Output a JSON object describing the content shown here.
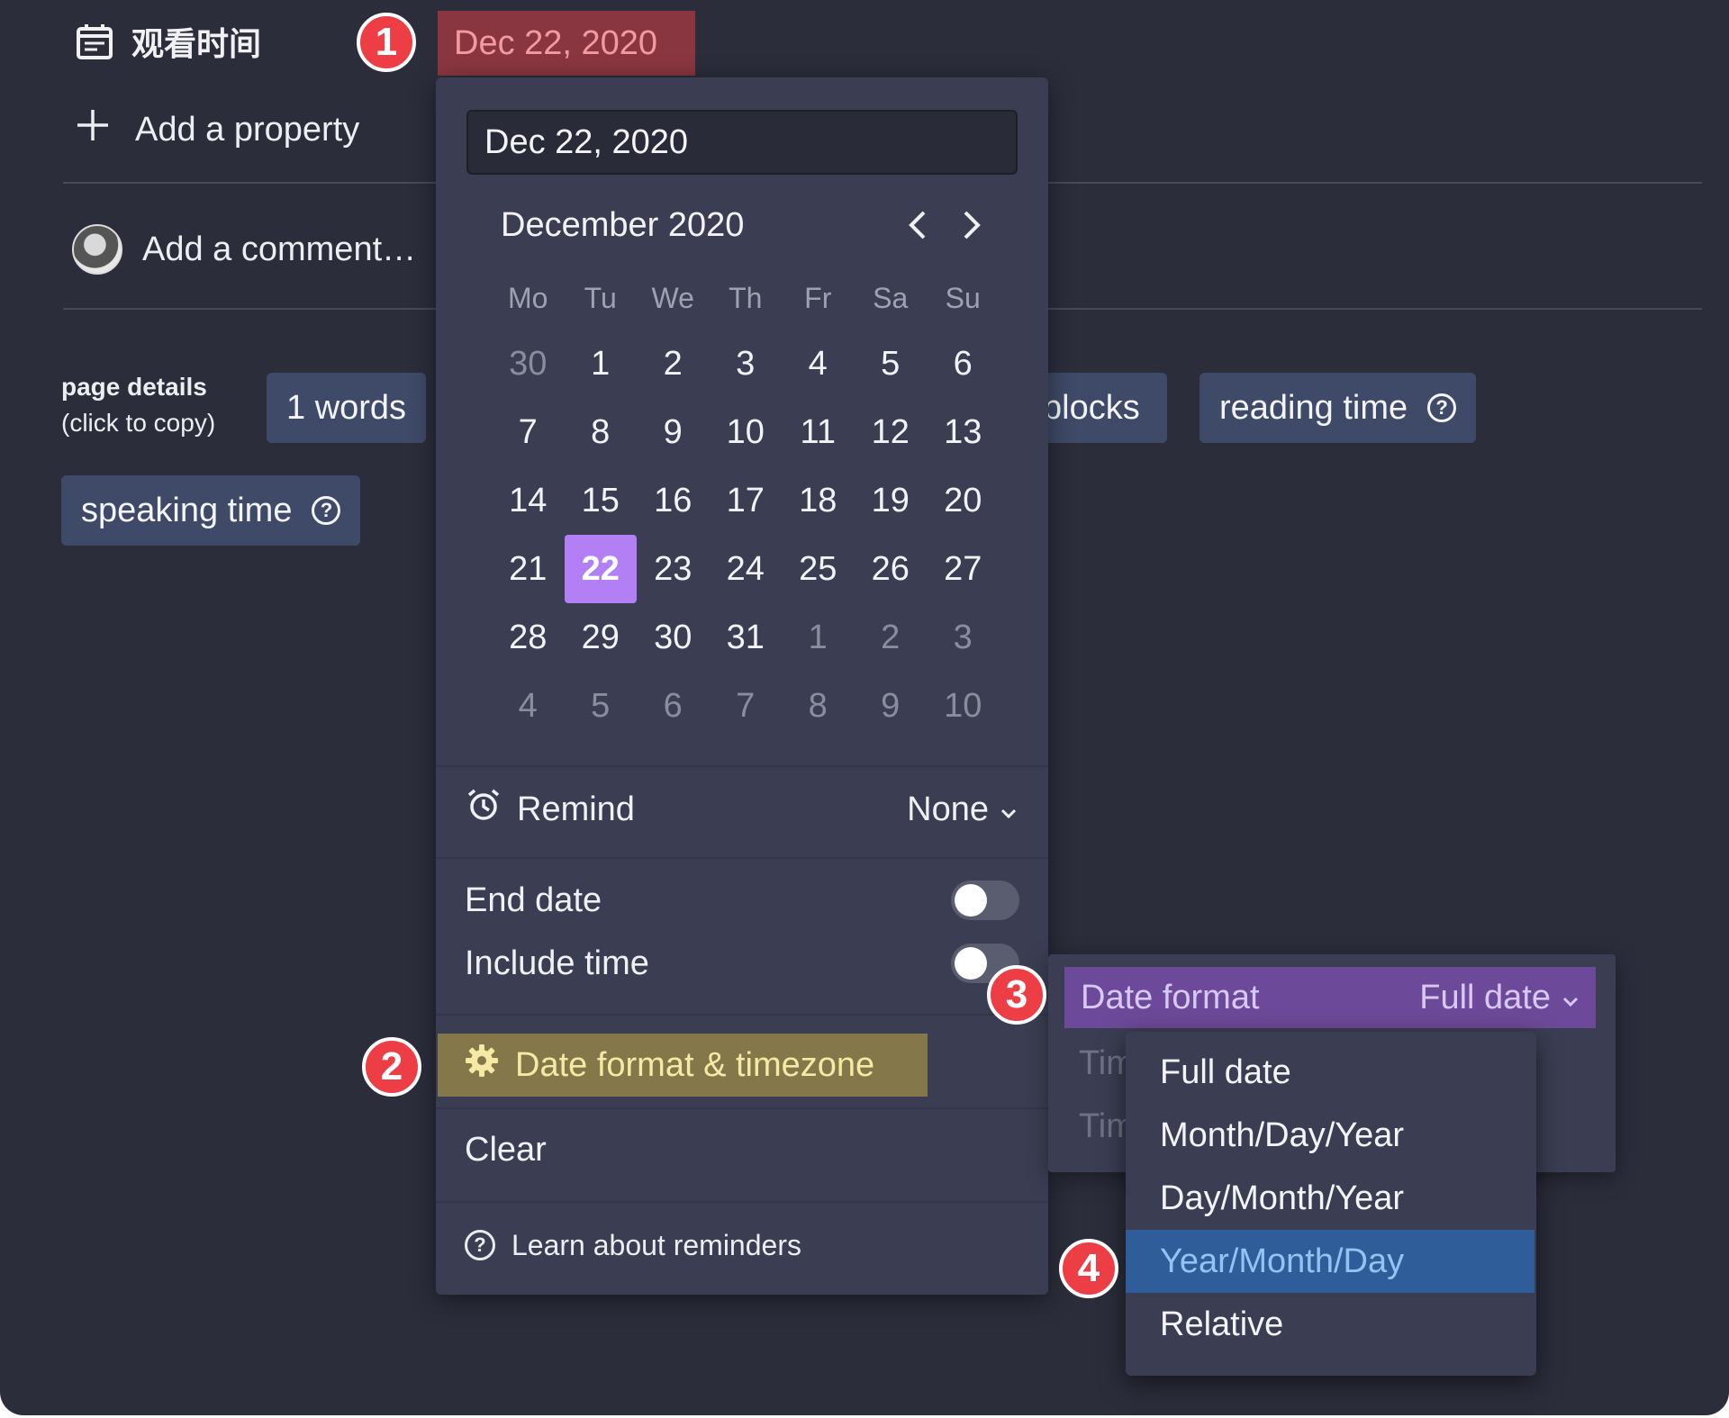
{
  "property": {
    "name": "观看时间",
    "icon": "calendar-icon",
    "value": "Dec 22, 2020"
  },
  "add_property": {
    "label": "Add a property",
    "icon": "plus-icon"
  },
  "add_comment": {
    "placeholder": "Add a comment…"
  },
  "page_details": {
    "title": "page details",
    "subtitle": "(click to copy)",
    "pills": [
      {
        "label": "1 words"
      },
      {
        "label": "blocks"
      },
      {
        "label": "reading time",
        "icon": "help-icon"
      },
      {
        "label": "speaking time",
        "icon": "help-icon"
      }
    ]
  },
  "picker": {
    "input_value": "Dec 22, 2020",
    "month_label": "December 2020",
    "weekdays": [
      "Mo",
      "Tu",
      "We",
      "Th",
      "Fr",
      "Sa",
      "Su"
    ],
    "weeks": [
      [
        "30",
        "1",
        "2",
        "3",
        "4",
        "5",
        "6"
      ],
      [
        "7",
        "8",
        "9",
        "10",
        "11",
        "12",
        "13"
      ],
      [
        "14",
        "15",
        "16",
        "17",
        "18",
        "19",
        "20"
      ],
      [
        "21",
        "22",
        "23",
        "24",
        "25",
        "26",
        "27"
      ],
      [
        "28",
        "29",
        "30",
        "31",
        "1",
        "2",
        "3"
      ],
      [
        "4",
        "5",
        "6",
        "7",
        "8",
        "9",
        "10"
      ]
    ],
    "selected_day": "22",
    "remind_label": "Remind",
    "remind_value": "None",
    "end_date_label": "End date",
    "end_date_on": false,
    "include_time_label": "Include time",
    "include_time_on": false,
    "date_format_button": "Date format & timezone",
    "clear_label": "Clear",
    "learn_label": "Learn about reminders"
  },
  "format_panel": {
    "label": "Date format",
    "value": "Full date",
    "ghost_rows": [
      "Tim",
      "Tim"
    ]
  },
  "format_options": [
    "Full date",
    "Month/Day/Year",
    "Day/Month/Year",
    "Year/Month/Day",
    "Relative"
  ],
  "format_highlighted": "Year/Month/Day",
  "badges": [
    "1",
    "2",
    "3",
    "4"
  ],
  "colors": {
    "background": "#2b2d3b",
    "popup": "#3b3e53",
    "selected_day": "#b37ff4",
    "date_chip": "#8a3641",
    "date_format_button": "#84784b",
    "format_header": "#6c4a99",
    "highlight_option": "#2f5d99",
    "badge": "#ee3e45"
  }
}
